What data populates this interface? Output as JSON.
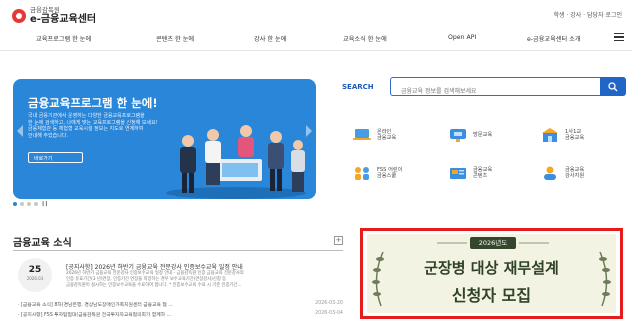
{
  "header": {
    "logo_sub": "금융감독원",
    "logo_main": "e-금융교육센터",
    "util_links": "학생 · 강사 · 담당자 로그인"
  },
  "gnb": {
    "items": [
      "교육프로그램 한 눈에",
      "콘텐츠 한 눈에",
      "강사 한 눈에",
      "교육소식 한 눈에",
      "Open API",
      "e-금융교육센터 소개"
    ]
  },
  "hero": {
    "title": "금융교육프로그램 한 눈에!",
    "description": "국내 금융기관에서 운영하는 다양한 금융교육프로그램을\n한 눈에 검색하고, 나에게 맞는 교육프로그램을 신청해 보세요!\n금융체험관 등 체험형 교육시설 정보는 지도로 연계하여\n안내해 주었습니다.",
    "button_label": "바로가기"
  },
  "search": {
    "label": "SEARCH",
    "placeholder": "금융교육 정보를 검색해보세요"
  },
  "quick_menu": {
    "items": [
      {
        "label": "온라인\n금융교육",
        "icon": "laptop-icon"
      },
      {
        "label": "방문교육",
        "icon": "presentation-icon"
      },
      {
        "label": "1사1교\n금융교육",
        "icon": "school-icon"
      },
      {
        "label": "FSS 어린이\n금융스쿨",
        "icon": "children-icon"
      },
      {
        "label": "금융교육\n콘텐츠",
        "icon": "contents-icon"
      },
      {
        "label": "금융교육\n강사지원",
        "icon": "instructor-icon"
      }
    ]
  },
  "news": {
    "title": "금융교육 소식",
    "more": "+",
    "featured": {
      "day": "25",
      "year_month": "2026.03",
      "title": "[공지사항] 2026년 하반기 금융교육 전문강사 인증보수교육 일정 안내",
      "body": "2026년 하반기 금융교육 전문강사 인증보수교육 일정 안내  -  금융감독원 인증 금융교육 전문강사의\n인증 유효기간(3 년)연장, 인증기간 연장을 희망하는 경우 보수교육기간(연장강사)신청 등\n금융감독원이 실시하는 인증보수교육을 수료하여 합니다.  * 인증보수교육 수료 시 기준 인증기간..."
    },
    "list": [
      {
        "text": "· [금융교육 소식] 8차(경남은행, 경상남도장애인가족지원센터 금융교육 협 ...",
        "date": "2026-03-20"
      },
      {
        "text": "· [공지사항] FSS 투자탐험대(금융감독원 전국투자자교육협의회가 함께하 ...",
        "date": "2026-03-04"
      }
    ]
  },
  "banner": {
    "ribbon": "2026년도",
    "line1": "군장병 대상 재무설계",
    "line2": "신청자 모집"
  },
  "colors": {
    "brand_blue": "#2a86d9",
    "search_blue": "#2165c7",
    "banner_border": "#e41c1c",
    "banner_green": "#2f4127"
  }
}
